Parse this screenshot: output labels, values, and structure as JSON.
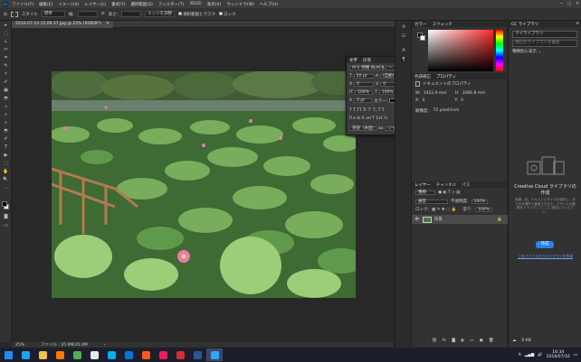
{
  "menu": [
    "ファイル(F)",
    "編集(E)",
    "イメージ(I)",
    "レイヤー(L)",
    "書式(Y)",
    "選択範囲(S)",
    "フィルター(T)",
    "3D(D)",
    "表示(V)",
    "ウィンドウ(W)",
    "ヘルプ(H)"
  ],
  "app_logo": "Ps",
  "window_controls": [
    "─",
    "□",
    "✕"
  ],
  "options": {
    "home": "⌂",
    "style_label": "スタイル",
    "style_value": "標準",
    "width_label": "幅:",
    "height_label": "高さ:",
    "feather_btn": "エッジを調整",
    "chk1": "選択範囲とマスク",
    "chk2": "ロック"
  },
  "doc_tab": "2016-07-14 15.09.37.jpg @ 25% (RGB/8*)",
  "doc_close": "✕",
  "status": {
    "zoom": "25%",
    "info": "ファイル : 35.0M/35.0M",
    "arrow": "›"
  },
  "tools": [
    "▸",
    "⬚",
    "ʟ",
    "✂",
    "⌗",
    "✎",
    "⚕",
    "✐",
    "▣",
    "◓",
    "♨",
    "⌕",
    "T",
    "▶",
    "✋",
    "🔍",
    "…"
  ],
  "color_panel": {
    "tabs": [
      "カラー",
      "スウォッチ"
    ],
    "hue_colors": [
      "#ff0000",
      "#ffff00",
      "#00ff00",
      "#00ffff",
      "#0000ff",
      "#ff00ff",
      "#ff0000"
    ],
    "base_color": "#ff2a2a"
  },
  "properties_panel": {
    "tabs": [
      "色調補正",
      "プロパティ"
    ],
    "doc_label": "ドキュメントのプロパティ",
    "w_label": "W:",
    "w_value": "1422.9 mm",
    "h_label": "H:",
    "h_value": "1066.8 mm",
    "x_label": "X:",
    "x_value": "0",
    "y_label": "Y:",
    "y_value": "0",
    "res_label": "解像度 :",
    "res_value": "72 pixel/inch"
  },
  "layers_panel": {
    "tabs": [
      "レイヤー",
      "チャンネル",
      "パス"
    ],
    "kind": "種類",
    "blend": "通常",
    "opacity_label": "不透明度:",
    "opacity": "100%",
    "lock_label": "ロック:",
    "fill_label": "塗り:",
    "fill": "100%",
    "layer_name": "背景"
  },
  "char_panel": {
    "tabs": [
      "文字",
      "段落"
    ],
    "font": "ＭＳ 明朝 BLACK",
    "style": "—",
    "size": "20 pt",
    "leading": "(自動)",
    "kerning": "0",
    "tracking": "0",
    "scale_v": "100%",
    "scale_h": "100%",
    "baseline": "0 pt",
    "color_label": "カラー:",
    "styles": "T  T  TT  Tr  T'  T,  T  Ŧ",
    "lang": "英語（米国）",
    "aa": "シャープ",
    "aa_prefix": "aa"
  },
  "libraries": {
    "tab": "CC ライブラリ",
    "menu": "≡",
    "selector": "マイライブラリ",
    "search_placeholder": "現在のライブラリを検索",
    "view_label": "種類別に表示 ⌄",
    "empty_title": "Creative Cloud ライブラリの作成",
    "empty_body": "画像、色、テキストスタイルを保存し、あらゆる場所で使用できます。デザインの要素をドラッグしてここに追加してください。",
    "create_btn": "作成",
    "link": "このファイルからライブラリを作成",
    "footer_count": "0 KB"
  },
  "taskbar": {
    "apps": [
      {
        "name": "start",
        "color": "#1e8fff"
      },
      {
        "name": "ie",
        "color": "#1da1f2"
      },
      {
        "name": "explorer",
        "color": "#f2c14e"
      },
      {
        "name": "media",
        "color": "#ff7a00"
      },
      {
        "name": "chrome",
        "color": "#4caf50"
      },
      {
        "name": "winamp",
        "color": "#e8e8e8"
      },
      {
        "name": "skype",
        "color": "#00aff0"
      },
      {
        "name": "edge",
        "color": "#0078d7"
      },
      {
        "name": "firefox",
        "color": "#ff5a1f"
      },
      {
        "name": "paint",
        "color": "#e91e63"
      },
      {
        "name": "acrobat",
        "color": "#d32f2f"
      },
      {
        "name": "winword",
        "color": "#2b579a"
      },
      {
        "name": "photoshop",
        "color": "#31a8ff"
      }
    ],
    "time": "16:34",
    "date": "2016/07/16",
    "lang": "A"
  }
}
